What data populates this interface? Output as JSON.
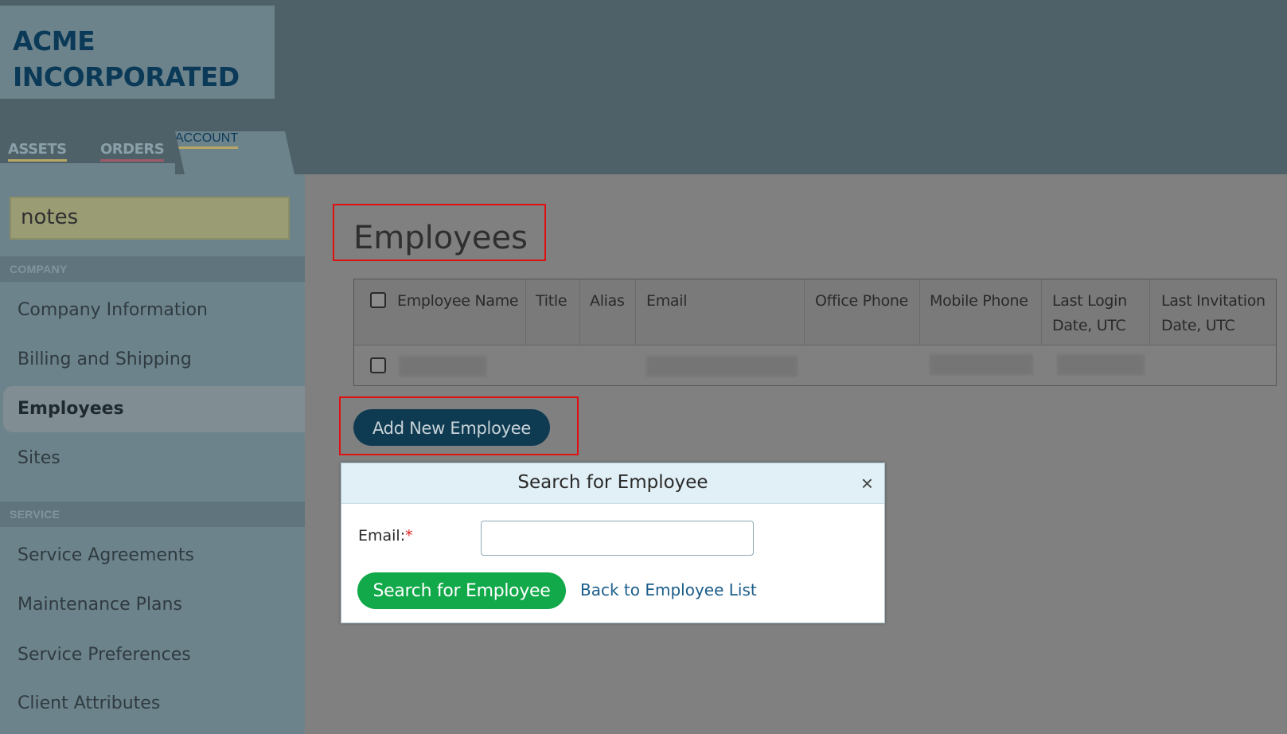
{
  "brand": {
    "line1": "ACME",
    "line2": "INCORPORATED"
  },
  "tabs": [
    {
      "label": "ASSETS"
    },
    {
      "label": "ORDERS"
    },
    {
      "label": "ACCOUNT"
    }
  ],
  "sidebar": {
    "notes": "notes",
    "company_heading": "COMPANY",
    "company_items": [
      "Company Information",
      "Billing and Shipping",
      "Employees",
      "Sites"
    ],
    "service_heading": "SERVICE",
    "service_items": [
      "Service Agreements",
      "Maintenance Plans",
      "Service Preferences",
      "Client Attributes"
    ]
  },
  "main": {
    "title": "Employees",
    "columns": [
      "Employee Name",
      "Title",
      "Alias",
      "Email",
      "Office Phone",
      "Mobile Phone",
      "Last Login Date, UTC",
      "Last Invitation Date, UTC"
    ],
    "add_button": "Add New Employee"
  },
  "modal": {
    "title": "Search for Employee",
    "close": "×",
    "email_label": "Email:",
    "required_mark": "*",
    "email_value": "",
    "search_button": "Search for Employee",
    "back_link": "Back to Employee List"
  }
}
